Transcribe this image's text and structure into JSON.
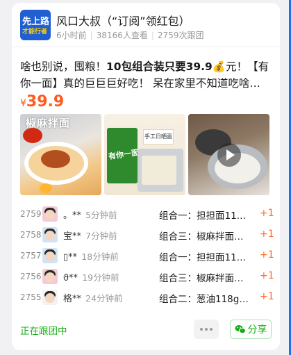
{
  "post": {
    "avatar": {
      "line1": "先上路",
      "line2": "才能行者"
    },
    "title": "风口大叔（“订阅”领红包）",
    "time": "6小时前",
    "views": "38166人查看",
    "joined": "2759次跟团",
    "content_before": "啥也别说，囤粮！",
    "content_bold": "10包组合装只要39.9",
    "content_emoji": "💰",
    "content_after": "元！【有你一面】真的巨巨巨好吃！ 呆在家里不知道吃啥…",
    "price_currency": "¥",
    "price_value": "39.9",
    "thumb1_tag": "椒麻拌面",
    "thumb2_pack": "有你一面",
    "thumb2_label": "手工日晒面"
  },
  "orders": [
    {
      "num": "2759",
      "name": "。**",
      "time": "5分钟前",
      "product": "组合一：担担面11…",
      "plus": "+1",
      "avatar": "pink"
    },
    {
      "num": "2758",
      "name": "宝**",
      "time": "7分钟前",
      "product": "组合三：椒麻拌面…",
      "plus": "+1",
      "avatar": "blue"
    },
    {
      "num": "2757",
      "name": "▯**",
      "time": "18分钟前",
      "product": "组合一：担担面11…",
      "plus": "+1",
      "avatar": "blue"
    },
    {
      "num": "2756",
      "name": "ϑ**",
      "time": "19分钟前",
      "product": "组合三：椒麻拌面…",
      "plus": "+1",
      "avatar": "pink"
    },
    {
      "num": "2755",
      "name": "格**",
      "time": "24分钟前",
      "product": "组合二：葱油118g…",
      "plus": "+1",
      "avatar": "white"
    }
  ],
  "footer": {
    "status": "正在跟团中",
    "share_label": "分享",
    "colors": {
      "accent_green": "#1aad19",
      "price_orange": "#ff5a1f"
    }
  }
}
